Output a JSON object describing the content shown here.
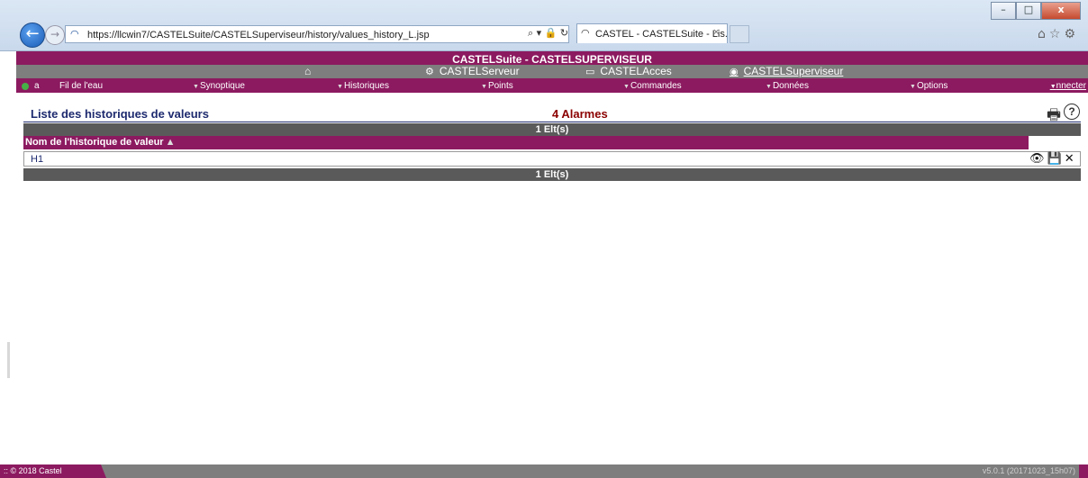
{
  "browser": {
    "url": "https://llcwin7/CASTELSuite/CASTELSuperviseur/history/values_history_L.jsp",
    "url_actions": "⌕ ▾ 🔒 ↻",
    "tab_title": "CASTEL - CASTELSuite - Lis...",
    "tab_close": "×",
    "window_buttons": [
      "–",
      "□",
      "x"
    ]
  },
  "app": {
    "title": "CASTELSuite - CASTELSUPERVISEUR",
    "nav": [
      {
        "label": "CASTELServeur",
        "icon": "gears-icon",
        "glyph": "⚙"
      },
      {
        "label": "CASTELAcces",
        "icon": "access-card-icon",
        "glyph": "▭"
      },
      {
        "label": "CASTELSuperviseur",
        "icon": "eye-icon",
        "glyph": "◉"
      }
    ],
    "home_glyph": "⌂",
    "user": "a",
    "menu": [
      "Fil de l'eau",
      "Synoptique",
      "Historiques",
      "Points",
      "Commandes",
      "Données",
      "Options"
    ],
    "connect_label": "nnecter"
  },
  "content": {
    "page_title": "Liste des historiques de valeurs",
    "alarms": "4 Alarmes",
    "count_top": "1 Elt(s)",
    "count_bottom": "1 Elt(s)",
    "column_header": "Nom de l'historique de valeur",
    "sort_glyph": "▲",
    "rows": [
      {
        "name": "H1"
      }
    ],
    "row_actions": {
      "view": "👁",
      "save": "💾",
      "delete": "✕"
    }
  },
  "footer": {
    "copyright": ":: © 2018 Castel",
    "version": "v5.0.1 (20171023_15h07)"
  },
  "colors": {
    "brand": "#8c1a60",
    "grey_bar": "#5a5a5a",
    "title_blue": "#1d2a6e",
    "alarm_red": "#8b0000"
  }
}
